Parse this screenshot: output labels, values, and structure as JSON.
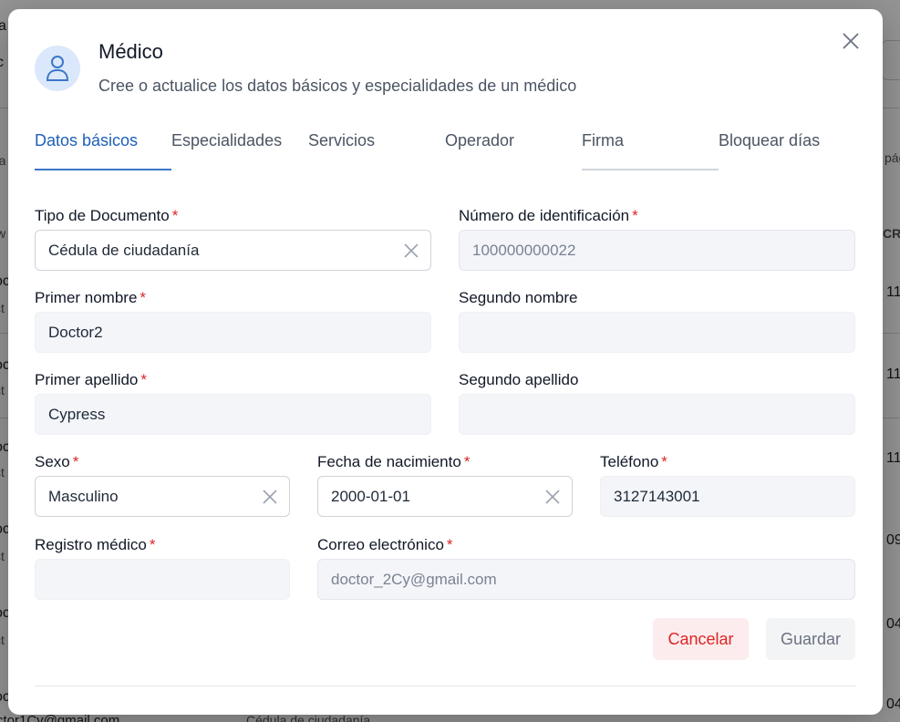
{
  "background": {
    "fragments": [
      "a",
      "c",
      "ra",
      "w",
      "oc",
      "ct",
      "oc",
      "ct",
      "oc",
      "ct",
      "oc",
      "ct",
      "oc",
      "ct",
      "oc",
      "ct",
      "ctor1Cy@gmail.com",
      "Cédula de ciudadanía",
      "pág",
      "CR",
      "11",
      "11",
      "11",
      "09",
      "04",
      "04"
    ]
  },
  "modal": {
    "title": "Médico",
    "subtitle": "Cree o actualice los datos básicos y especialidades de un médico",
    "close_icon": "close-icon",
    "avatar_icon": "user-icon"
  },
  "tabs": [
    {
      "label": "Datos básicos",
      "active": true
    },
    {
      "label": "Especialidades",
      "active": false
    },
    {
      "label": "Servicios",
      "active": false
    },
    {
      "label": "Operador",
      "active": false
    },
    {
      "label": "Firma",
      "active": false
    },
    {
      "label": "Bloquear días",
      "active": false
    }
  ],
  "form": {
    "required_mark": "*",
    "tipo_documento": {
      "label": "Tipo de Documento",
      "value": "Cédula de ciudadanía"
    },
    "numero_identificacion": {
      "label": "Número de identificación",
      "value": "100000000022"
    },
    "primer_nombre": {
      "label": "Primer nombre",
      "value": "Doctor2"
    },
    "segundo_nombre": {
      "label": "Segundo nombre",
      "value": ""
    },
    "primer_apellido": {
      "label": "Primer apellido",
      "value": "Cypress"
    },
    "segundo_apellido": {
      "label": "Segundo apellido",
      "value": ""
    },
    "sexo": {
      "label": "Sexo",
      "value": "Masculino"
    },
    "fecha_nacimiento": {
      "label": "Fecha de nacimiento",
      "value": "2000-01-01"
    },
    "telefono": {
      "label": "Teléfono",
      "value": "3127143001"
    },
    "registro_medico": {
      "label": "Registro médico",
      "value": ""
    },
    "correo": {
      "label": "Correo electrónico",
      "value": "doctor_2Cy@gmail.com"
    }
  },
  "actions": {
    "cancel_label": "Cancelar",
    "save_label": "Guardar"
  },
  "colors": {
    "accent": "#1e5fb8",
    "required": "#dc2626",
    "cancel_bg": "#fdeced"
  }
}
